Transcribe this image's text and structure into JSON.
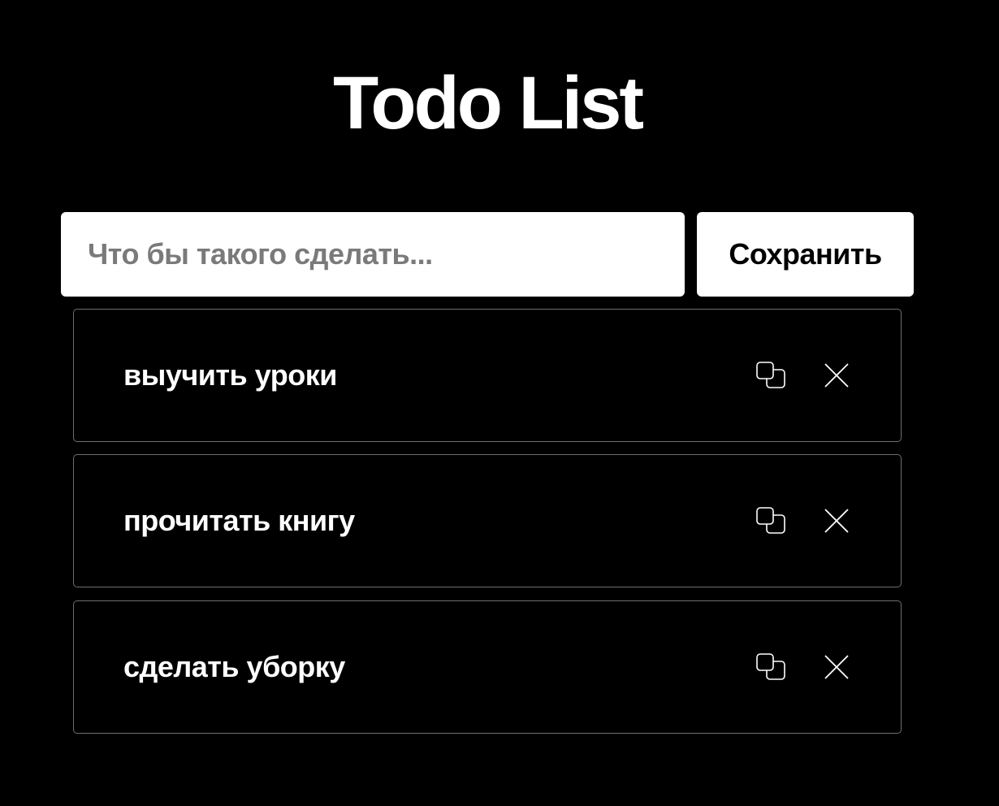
{
  "app": {
    "title": "Todo List"
  },
  "form": {
    "input_placeholder": "Что бы такого сделать...",
    "input_value": "",
    "save_label": "Сохранить"
  },
  "todos": [
    {
      "text": "выучить уроки",
      "copy_icon": "copy-icon",
      "delete_icon": "close-icon"
    },
    {
      "text": "прочитать книгу",
      "copy_icon": "copy-icon",
      "delete_icon": "close-icon"
    },
    {
      "text": "сделать уборку",
      "copy_icon": "copy-icon",
      "delete_icon": "close-icon"
    }
  ],
  "colors": {
    "background": "#000000",
    "foreground": "#ffffff",
    "placeholder": "#7a7a7a",
    "item_border": "#6e6e6e"
  }
}
